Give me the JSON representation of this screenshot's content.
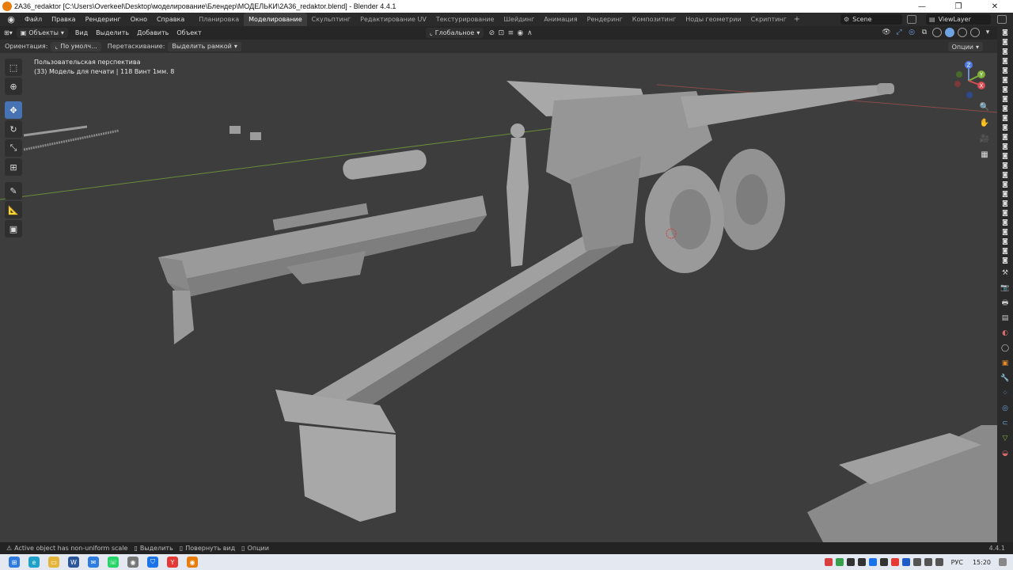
{
  "window": {
    "title": "2A36_redaktor [C:\\Users\\Overkeel\\Desktop\\моделирование\\Блендер\\МОДЕЛЬКИ\\2A36_redaktor.blend] - Blender 4.4.1",
    "min_icon": "minimize-icon",
    "restore_icon": "restore-icon",
    "close_icon": "close-icon"
  },
  "menu": [
    "Файл",
    "Правка",
    "Рендеринг",
    "Окно",
    "Справка"
  ],
  "workspaces": [
    {
      "label": "Планировка",
      "active": false
    },
    {
      "label": "Моделирование",
      "active": true
    },
    {
      "label": "Скульптинг",
      "active": false
    },
    {
      "label": "Редактирование UV",
      "active": false
    },
    {
      "label": "Текстурирование",
      "active": false
    },
    {
      "label": "Шейдинг",
      "active": false
    },
    {
      "label": "Анимация",
      "active": false
    },
    {
      "label": "Рендеринг",
      "active": false
    },
    {
      "label": "Композитинг",
      "active": false
    },
    {
      "label": "Ноды геометрии",
      "active": false
    },
    {
      "label": "Скриптинг",
      "active": false
    }
  ],
  "scene": {
    "label": "Scene"
  },
  "view_layer": {
    "label": "ViewLayer"
  },
  "viewport_header": {
    "mode": "Объекты",
    "menus": [
      "Вид",
      "Выделить",
      "Добавить",
      "Объект"
    ],
    "transform_orientation": "Глобальное"
  },
  "tool_settings": {
    "orientation_label": "Ориентация:",
    "orientation_value": "По умолч...",
    "drag_label": "Перетаскивание:",
    "drag_value": "Выделить рамкой",
    "options": "Опции"
  },
  "viewport": {
    "perspective": "Пользовательская перспектива",
    "object_info": "(33) Модель для печати | 118 Винт 1мм. 8"
  },
  "accent_color": "#4772b3",
  "gizmo": {
    "x": "X",
    "y": "Y",
    "z": "Z"
  },
  "status": {
    "warning": "Active object has non-uniform scale",
    "select": "Выделить",
    "rotate": "Повернуть вид",
    "options": "Опции",
    "version": "4.4.1"
  },
  "taskbar": {
    "lang": "РУС",
    "time": "15:20"
  }
}
